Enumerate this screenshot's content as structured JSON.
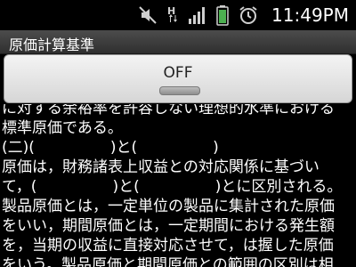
{
  "status_bar": {
    "time": "11:49PM",
    "signal_label": "H",
    "icons": [
      "mute-icon",
      "hsdpa-icon",
      "signal-icon",
      "battery-icon",
      "alarm-icon"
    ],
    "battery_color": "#4caf50"
  },
  "app": {
    "title": "原価計算基準",
    "title_bar_color": "#3a3a3a"
  },
  "toggle": {
    "label": "OFF",
    "state": "off"
  },
  "content": {
    "lines": [
      "に対する余裕率を許容しない理想的水準における",
      "標準原価である。",
      "(二)(　　　　　)と(　　　　　)",
      "原価は，財務諸表上収益との対応関係に基づい",
      "て，(　　　　　)と(　　　　　)とに区別される。",
      "製品原価とは，一定単位の製品に集計された原価",
      "をいい，期間原価とは，一定期間における発生額",
      "を，当期の収益に直接対応させて，は握した原価",
      "をいう。製品原価と期間原価との範囲の区別は相"
    ]
  }
}
